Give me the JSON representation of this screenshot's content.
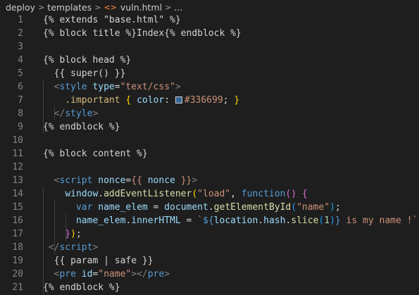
{
  "breadcrumb": {
    "items": [
      "deploy",
      "templates",
      "vuln.html",
      "..."
    ],
    "separator": ">",
    "file_icon": "<>"
  },
  "colors": {
    "swatch": "#336699",
    "background": "#1e1e1e"
  },
  "lines": [
    {
      "n": "1",
      "tokens": [
        [
          "j",
          "{% extends \"base.html\" %}"
        ]
      ]
    },
    {
      "n": "2",
      "tokens": [
        [
          "j",
          "{% block title %}Index{% endblock %}"
        ]
      ]
    },
    {
      "n": "3",
      "tokens": []
    },
    {
      "n": "4",
      "tokens": [
        [
          "j",
          "{% block head %}"
        ]
      ]
    },
    {
      "n": "5",
      "tokens": [
        [
          "j",
          "  {{ super() }}"
        ]
      ]
    },
    {
      "n": "6",
      "tokens": [
        [
          "j",
          "  "
        ],
        [
          "tag",
          "<"
        ],
        [
          "name",
          "style"
        ],
        [
          "j",
          " "
        ],
        [
          "attr",
          "type"
        ],
        [
          "j",
          "="
        ],
        [
          "str",
          "\"text/css\""
        ],
        [
          "tag",
          ">"
        ]
      ]
    },
    {
      "n": "7",
      "tokens": [
        [
          "j",
          "    "
        ],
        [
          "sel",
          ".important"
        ],
        [
          "j",
          " "
        ],
        [
          "gold",
          "{"
        ],
        [
          "j",
          " "
        ],
        [
          "prop",
          "color"
        ],
        [
          "j",
          ": "
        ],
        [
          "swatch",
          ""
        ],
        [
          "num",
          "#336699"
        ],
        [
          "j",
          "; "
        ],
        [
          "gold",
          "}"
        ]
      ]
    },
    {
      "n": "8",
      "tokens": [
        [
          "j",
          "  "
        ],
        [
          "tag",
          "</"
        ],
        [
          "name",
          "style"
        ],
        [
          "tag",
          ">"
        ]
      ]
    },
    {
      "n": "9",
      "tokens": [
        [
          "j",
          "{% endblock %}"
        ]
      ]
    },
    {
      "n": "10",
      "tokens": []
    },
    {
      "n": "11",
      "tokens": [
        [
          "j",
          "{% block content %}"
        ]
      ]
    },
    {
      "n": "12",
      "tokens": []
    },
    {
      "n": "13",
      "tokens": [
        [
          "j",
          "  "
        ],
        [
          "tag",
          "<"
        ],
        [
          "name",
          "script"
        ],
        [
          "j",
          " "
        ],
        [
          "attr",
          "nonce"
        ],
        [
          "j",
          "="
        ],
        [
          "str",
          "{{"
        ],
        [
          "j",
          " "
        ],
        [
          "attr",
          "nonce"
        ],
        [
          "j",
          " "
        ],
        [
          "str",
          "}}"
        ],
        [
          "tag",
          ">"
        ]
      ]
    },
    {
      "n": "14",
      "tokens": [
        [
          "j",
          "    "
        ],
        [
          "var",
          "window"
        ],
        [
          "j",
          "."
        ],
        [
          "fn",
          "addEventListener"
        ],
        [
          "gold",
          "("
        ],
        [
          "str",
          "\"load\""
        ],
        [
          "j",
          ", "
        ],
        [
          "kw",
          "function"
        ],
        [
          "purple",
          "()"
        ],
        [
          "j",
          " "
        ],
        [
          "purple",
          "{"
        ]
      ]
    },
    {
      "n": "15",
      "tokens": [
        [
          "j",
          "      "
        ],
        [
          "kw",
          "var"
        ],
        [
          "j",
          " "
        ],
        [
          "var",
          "name_elem"
        ],
        [
          "j",
          " = "
        ],
        [
          "var",
          "document"
        ],
        [
          "j",
          "."
        ],
        [
          "fn",
          "getElementById"
        ],
        [
          "blue",
          "("
        ],
        [
          "str",
          "\"name\""
        ],
        [
          "blue",
          ")"
        ],
        [
          "j",
          ";"
        ]
      ]
    },
    {
      "n": "16",
      "tokens": [
        [
          "j",
          "      "
        ],
        [
          "var",
          "name_elem"
        ],
        [
          "j",
          "."
        ],
        [
          "var",
          "innerHTML"
        ],
        [
          "j",
          " = "
        ],
        [
          "str",
          "`"
        ],
        [
          "kw",
          "${"
        ],
        [
          "var",
          "location"
        ],
        [
          "j",
          "."
        ],
        [
          "var",
          "hash"
        ],
        [
          "j",
          "."
        ],
        [
          "fn",
          "slice"
        ],
        [
          "blue",
          "("
        ],
        [
          "bnum",
          "1"
        ],
        [
          "blue",
          ")"
        ],
        [
          "kw",
          "}"
        ],
        [
          "str",
          " is my name !`"
        ],
        [
          "j",
          ";"
        ]
      ]
    },
    {
      "n": "17",
      "tokens": [
        [
          "j",
          "    "
        ],
        [
          "purple",
          "}"
        ],
        [
          "gold",
          ")"
        ],
        [
          "j",
          ";"
        ]
      ]
    },
    {
      "n": "18",
      "tokens": [
        [
          "j",
          " "
        ],
        [
          "tag",
          "</"
        ],
        [
          "name",
          "script"
        ],
        [
          "tag",
          ">"
        ]
      ]
    },
    {
      "n": "19",
      "tokens": [
        [
          "j",
          "  {{ param | safe }}"
        ]
      ]
    },
    {
      "n": "20",
      "tokens": [
        [
          "j",
          "  "
        ],
        [
          "tag",
          "<"
        ],
        [
          "name",
          "pre"
        ],
        [
          "j",
          " "
        ],
        [
          "attr",
          "id"
        ],
        [
          "j",
          "="
        ],
        [
          "str",
          "\"name\""
        ],
        [
          "tag",
          "></"
        ],
        [
          "name",
          "pre"
        ],
        [
          "tag",
          ">"
        ]
      ]
    },
    {
      "n": "21",
      "tokens": [
        [
          "j",
          "{% endblock %}"
        ]
      ]
    }
  ]
}
